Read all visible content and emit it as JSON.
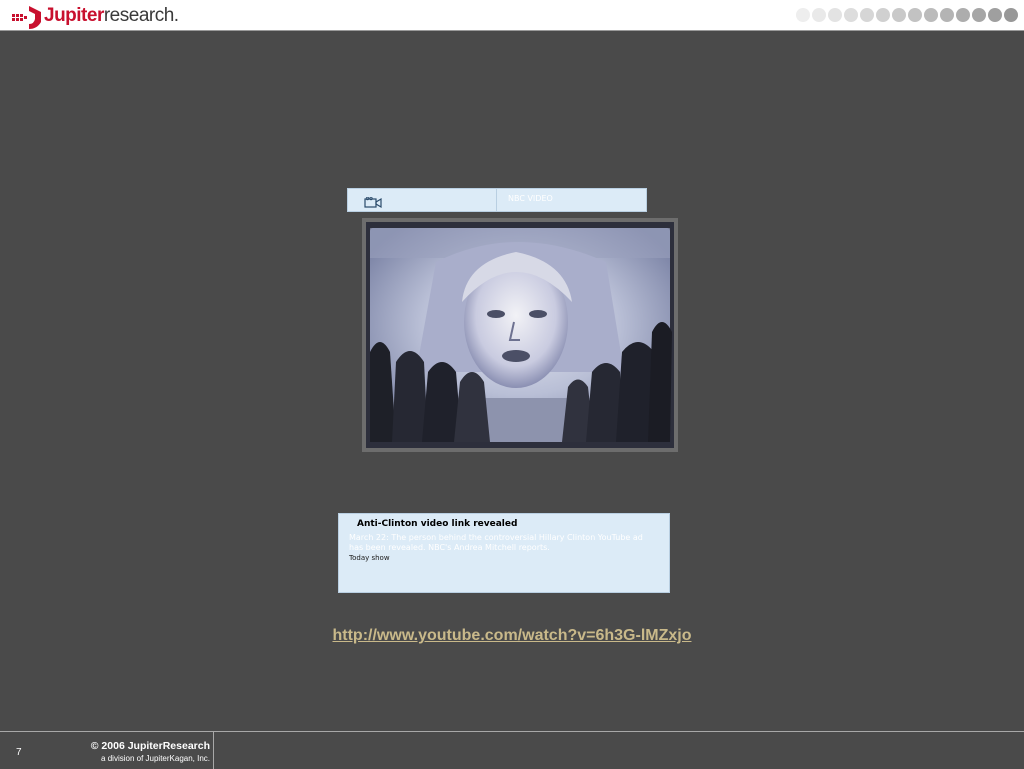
{
  "header": {
    "logo_brand": "Jupiter",
    "logo_suffix": "research",
    "logo_trademark": ".",
    "dot_colors": [
      "#eeeeee",
      "#e9e9e9",
      "#e3e3e3",
      "#dddddd",
      "#d6d6d6",
      "#d0d0d0",
      "#c9c9c9",
      "#c2c2c2",
      "#bbbbbb",
      "#b4b4b4",
      "#adadad",
      "#a6a6a6",
      "#9f9f9f",
      "#989898"
    ]
  },
  "video_player": {
    "icon": "video-camera-icon",
    "source_label": "NBC VIDEO",
    "still_icon": "video-still-frame"
  },
  "caption": {
    "title": "Anti-Clinton video link revealed",
    "description": "March 22: The person behind the controversial Hillary Clinton YouTube ad has been revealed. NBC's Andrea Mitchell reports.",
    "source": "Today show"
  },
  "link": {
    "url": "http://www.youtube.com/watch?v=6h3G-lMZxjo"
  },
  "footer": {
    "page_number": "7",
    "copyright": "© 2006 JupiterResearch",
    "division": "a division of JupiterKagan, Inc."
  },
  "colors": {
    "background": "#4a4a4a",
    "brand_red": "#c8102e",
    "panel_blue": "#dcebf7",
    "link": "#c9b98a"
  }
}
